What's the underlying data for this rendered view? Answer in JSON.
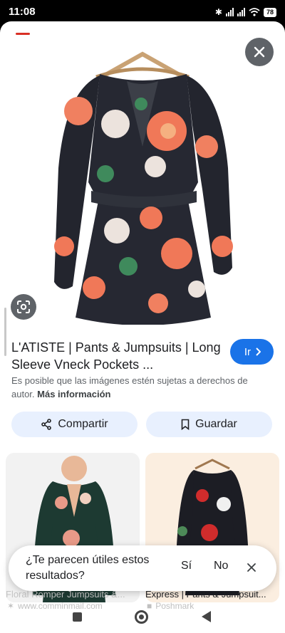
{
  "status_bar": {
    "time": "11:08",
    "battery": "78"
  },
  "result": {
    "title": "L'ATISTE | Pants & Jumpsuits | Long Sleeve Vneck Pockets ...",
    "visit_label": "Ir",
    "copyright_text": "Es posible que las imágenes estén sujetas a derechos de autor.",
    "more_info_label": "Más información",
    "share_label": "Compartir",
    "save_label": "Guardar"
  },
  "related": [
    {
      "caption": "Floral Romper Jumpsuits &...",
      "source": "www.comminmail.com"
    },
    {
      "caption": "Express | Pants & Jumpsuit...",
      "source": "Poshmark"
    }
  ],
  "feedback": {
    "question": "¿Te parecen útiles estos resultados?",
    "yes_label": "Sí",
    "no_label": "No"
  },
  "colors": {
    "accent": "#1a73e8",
    "chip_bg": "#e8f0fe",
    "dark_button": "#5f6368"
  }
}
